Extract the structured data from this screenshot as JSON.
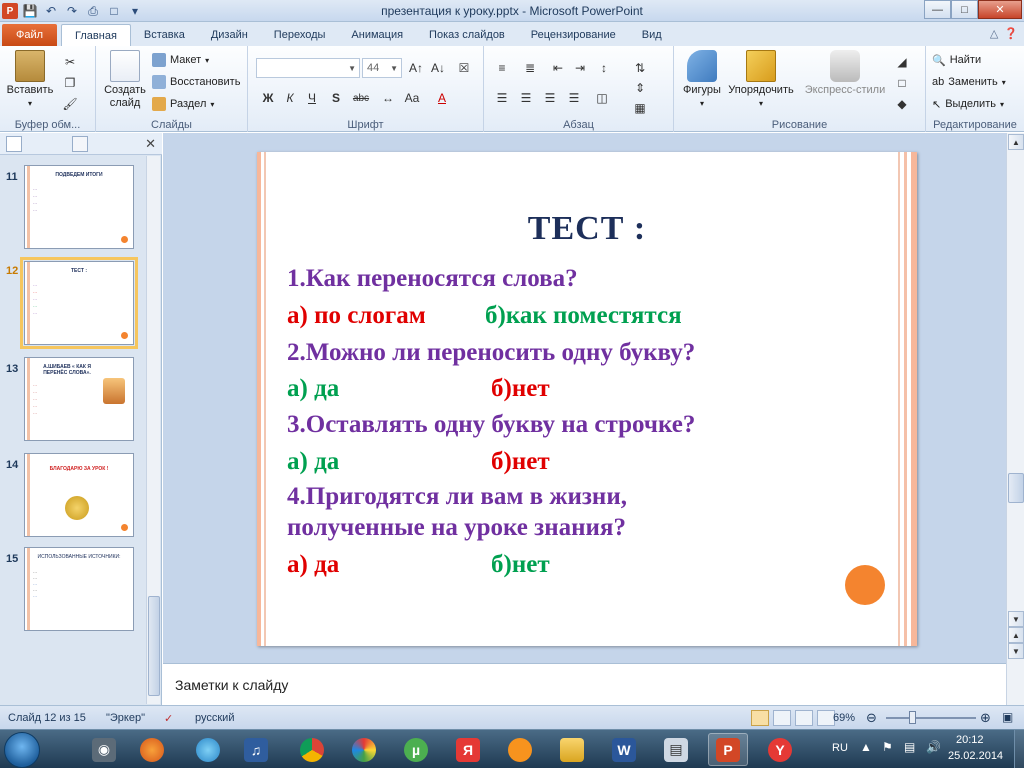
{
  "window": {
    "title": "презентация к уроку.pptx - Microsoft PowerPoint",
    "app_badge": "P"
  },
  "tabs": [
    {
      "label": "Файл"
    },
    {
      "label": "Главная"
    },
    {
      "label": "Вставка"
    },
    {
      "label": "Дизайн"
    },
    {
      "label": "Переходы"
    },
    {
      "label": "Анимация"
    },
    {
      "label": "Показ слайдов"
    },
    {
      "label": "Рецензирование"
    },
    {
      "label": "Вид"
    }
  ],
  "active_tab": "Главная",
  "ribbon": {
    "groups": {
      "clipboard": "Буфер обм...",
      "slides": "Слайды",
      "font": "Шрифт",
      "paragraph": "Абзац",
      "drawing": "Рисование",
      "editing": "Редактирование"
    },
    "paste": "Вставить",
    "new_slide": "Создать слайд",
    "layout": "Макет",
    "reset": "Восстановить",
    "section": "Раздел",
    "font_name": "",
    "font_size": "44",
    "bold": "Ж",
    "italic": "К",
    "underline": "Ч",
    "strike": "abc",
    "shapes": "Фигуры",
    "arrange": "Упорядочить",
    "quick_styles": "Экспресс-стили",
    "find": "Найти",
    "replace": "Заменить",
    "select": "Выделить"
  },
  "thumbnails": [
    {
      "num": "11",
      "title": "ПОДВЕДЕМ ИТОГИ"
    },
    {
      "num": "12",
      "title": "ТЕСТ :"
    },
    {
      "num": "13",
      "title": "А.ШИБАЕВ « КАК Я ПЕРЕНЁС СЛОВА»."
    },
    {
      "num": "14",
      "title": "БЛАГОДАРЮ ЗА УРОК !"
    },
    {
      "num": "15",
      "title": "ИСПОЛЬЗОВАННЫЕ ИСТОЧНИКИ:"
    }
  ],
  "slide": {
    "title": "ТЕСТ :",
    "q1": "1.Как переносятся слова?",
    "q1_a": "а) по слогам",
    "q1_b": "б)как поместятся",
    "q2": "2.Можно ли переносить одну букву?",
    "q2_a": "а) да",
    "q2_b": "б)нет",
    "q3": "3.Оставлять одну букву на строчке?",
    "q3_a": "а) да",
    "q3_b": "б)нет",
    "q4_line1": "4.Пригодятся ли вам в жизни,",
    "q4_line2": "полученные на уроке знания?",
    "q4_a": "а) да",
    "q4_b": "б)нет"
  },
  "notes_placeholder": "Заметки к слайду",
  "status": {
    "slide_info": "Слайд 12 из 15",
    "theme": "\"Эркер\"",
    "language": "русский",
    "zoom": "69%"
  },
  "taskbar": {
    "lang": "RU",
    "time": "20:12",
    "date": "25.02.2014"
  },
  "colors": {
    "accent_orange": "#f4842f",
    "question_purple": "#7030a0",
    "answer_red": "#e00000",
    "answer_green": "#00a050",
    "title_navy": "#1d2f5a"
  }
}
